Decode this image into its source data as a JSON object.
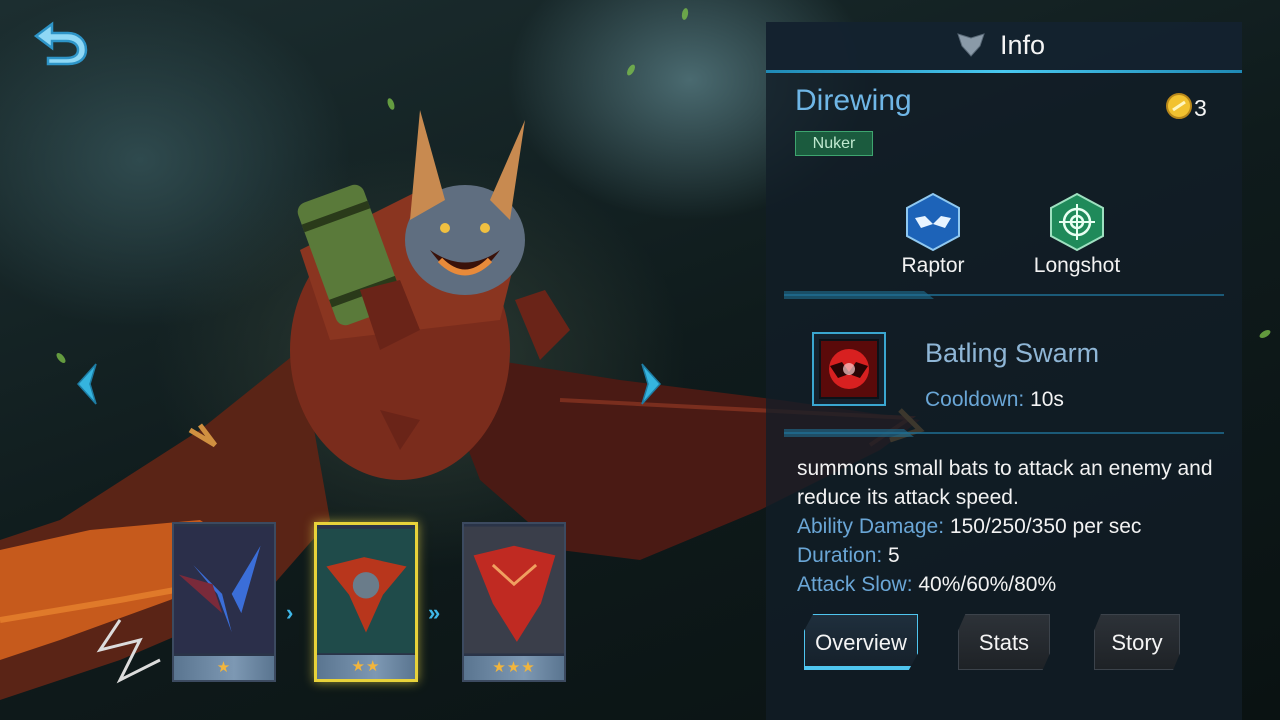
{
  "navigation": {
    "back_icon": "back-arrow-icon",
    "prev_icon": "chevron-left-icon",
    "next_icon": "chevron-right-icon"
  },
  "skins": [
    {
      "stars": "★",
      "selected": false,
      "tint": "#3b4fa8"
    },
    {
      "stars": "★★",
      "selected": true,
      "tint": "#b83a28"
    },
    {
      "stars": "★★★",
      "selected": false,
      "tint": "#c2302a"
    }
  ],
  "panel": {
    "header_title": "Info",
    "hero_name": "Direwing",
    "role": "Nuker",
    "coin_count": "3",
    "specialties": [
      {
        "label": "Raptor",
        "icon": "bat-icon",
        "color": "#1d63b8"
      },
      {
        "label": "Longshot",
        "icon": "crosshair-icon",
        "color": "#1f8a5a"
      }
    ],
    "skill": {
      "name": "Batling Swarm",
      "cooldown_label": "Cooldown:",
      "cooldown_value": " 10s",
      "description": "summons small bats to attack an enemy and reduce its attack speed.",
      "stats": [
        {
          "label": "Ability Damage:",
          "value": " 150/250/350 per sec"
        },
        {
          "label": "Duration:",
          "value": " 5"
        },
        {
          "label": "Attack Slow:",
          "value": " 40%/60%/80%"
        }
      ]
    },
    "tabs": [
      {
        "label": "Overview",
        "active": true
      },
      {
        "label": "Stats",
        "active": false
      },
      {
        "label": "Story",
        "active": false
      }
    ]
  },
  "colors": {
    "accent": "#49c9f0",
    "label_blue": "#6aa6d6",
    "selected_gold": "#e8d23a",
    "star_orange": "#f2b53c"
  }
}
